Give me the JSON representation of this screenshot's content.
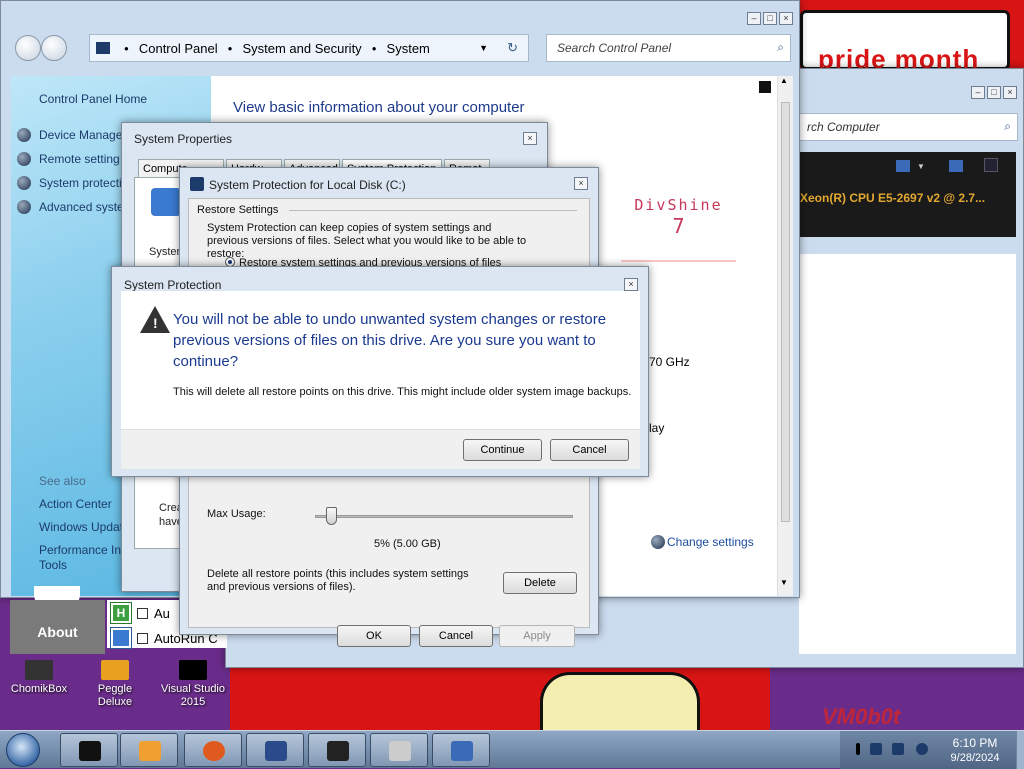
{
  "desktop": {
    "banner_text": "pride month",
    "brand_text": "VM0b0t",
    "icons": [
      {
        "label": "ChomikBox"
      },
      {
        "label": "Peggle Deluxe"
      },
      {
        "label": "Visual Studio 2015"
      }
    ]
  },
  "control_panel": {
    "breadcrumb": [
      "Control Panel",
      "System and Security",
      "System"
    ],
    "search_placeholder": "Search Control Panel",
    "left_home": "Control Panel Home",
    "left_links": [
      "Device Manage",
      "Remote setting",
      "System protecti",
      "Advanced syste"
    ],
    "see_also_label": "See also",
    "see_also_links": [
      "Action Center",
      "Windows Updat",
      "Performance In",
      "Tools"
    ],
    "main_title": "View basic information about your computer",
    "logo_line1": "DivShine",
    "logo_line2": "7",
    "cpu_speed_frag": "70 GHz",
    "display_frag": "lay",
    "change_settings": "Change settings"
  },
  "computer_window": {
    "search_placeholder": "rch Computer",
    "cpu_text": "Xeon(R) CPU E5-2697 v2 @ 2.7..."
  },
  "about_panel": {
    "about_label": "About",
    "startup_items": [
      {
        "label": "Au"
      },
      {
        "label": "AutoRun C"
      }
    ]
  },
  "system_properties": {
    "title": "System Properties",
    "tabs": [
      "Compute",
      "Hardw",
      "Advanced",
      "System Protection",
      "Remot"
    ],
    "body_frag1": "Systen",
    "body_frag2": "Crea",
    "body_frag3": "have"
  },
  "system_protection_disk": {
    "title": "System Protection for Local Disk (C:)",
    "group_label": "Restore Settings",
    "description": "System Protection can keep copies of system settings and previous versions of files. Select what you would like to be able to restore:",
    "radio_label": "Restore system settings and previous versions of files",
    "max_usage_label": "Max Usage:",
    "usage_value": "5% (5.00 GB)",
    "usage_fraction": 0.05,
    "delete_text": "Delete all restore points (this includes system settings and previous versions of files).",
    "delete_button": "Delete",
    "ok_button": "OK",
    "cancel_button": "Cancel",
    "apply_button": "Apply"
  },
  "confirm_dialog": {
    "title": "System Protection",
    "main_message": "You will not be able to undo unwanted system changes or restore previous versions of files on this drive. Are you sure you want to continue?",
    "sub_message": "This will delete all restore points on this drive. This might include older system image backups.",
    "continue_button": "Continue",
    "cancel_button": "Cancel"
  },
  "taskbar": {
    "time": "6:10 PM",
    "date": "9/28/2024"
  },
  "colors": {
    "link_blue": "#1c3b6a",
    "instruction_blue": "#1a3a8f",
    "taskbar": "#5f7896"
  }
}
